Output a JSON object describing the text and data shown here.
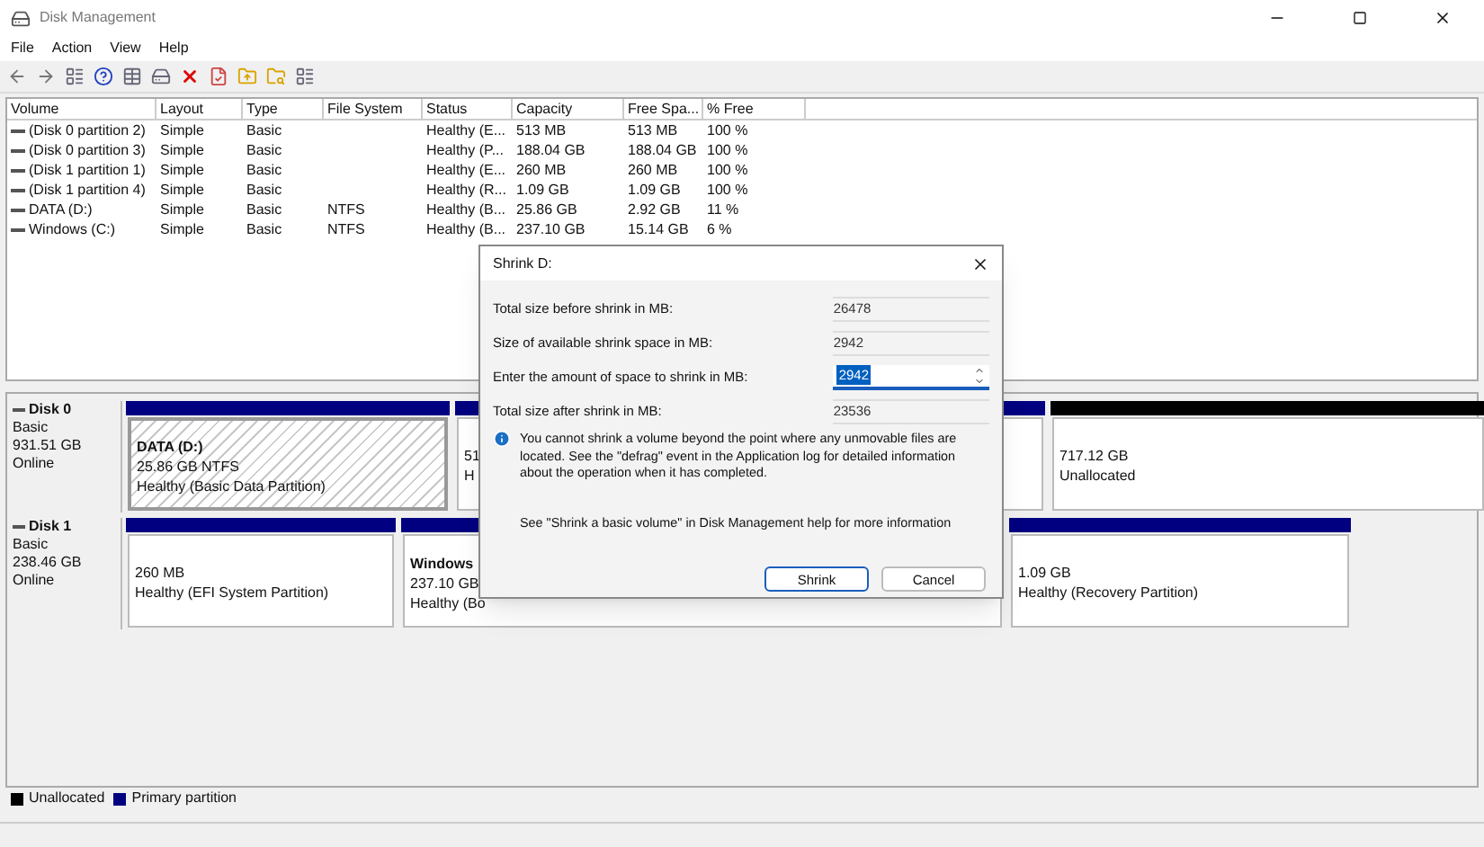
{
  "window": {
    "title": "Disk Management"
  },
  "menu": [
    "File",
    "Action",
    "View",
    "Help"
  ],
  "table": {
    "columns": [
      "Volume",
      "Layout",
      "Type",
      "File System",
      "Status",
      "Capacity",
      "Free Spa...",
      "% Free"
    ],
    "rows": [
      [
        "(Disk 0 partition 2)",
        "Simple",
        "Basic",
        "",
        "Healthy (E...",
        "513 MB",
        "513 MB",
        "100 %"
      ],
      [
        "(Disk 0 partition 3)",
        "Simple",
        "Basic",
        "",
        "Healthy (P...",
        "188.04 GB",
        "188.04 GB",
        "100 %"
      ],
      [
        "(Disk 1 partition 1)",
        "Simple",
        "Basic",
        "",
        "Healthy (E...",
        "260 MB",
        "260 MB",
        "100 %"
      ],
      [
        "(Disk 1 partition 4)",
        "Simple",
        "Basic",
        "",
        "Healthy (R...",
        "1.09 GB",
        "1.09 GB",
        "100 %"
      ],
      [
        "DATA (D:)",
        "Simple",
        "Basic",
        "NTFS",
        "Healthy (B...",
        "25.86 GB",
        "2.92 GB",
        "11 %"
      ],
      [
        "Windows (C:)",
        "Simple",
        "Basic",
        "NTFS",
        "Healthy (B...",
        "237.10 GB",
        "15.14 GB",
        "6 %"
      ]
    ]
  },
  "disks": [
    {
      "name": "Disk 0",
      "type": "Basic",
      "size": "931.51 GB",
      "status": "Online",
      "partitions": [
        {
          "kind": "primary",
          "selected": true,
          "name": "DATA  (D:)",
          "size": "25.86 GB NTFS",
          "status": "Healthy (Basic Data Partition)"
        },
        {
          "kind": "primary",
          "selected": false,
          "size": "51",
          "status": "H"
        },
        {
          "kind": "primary",
          "selected": false
        },
        {
          "kind": "unallocated",
          "selected": false,
          "size": "717.12 GB",
          "status": "Unallocated"
        }
      ]
    },
    {
      "name": "Disk 1",
      "type": "Basic",
      "size": "238.46 GB",
      "status": "Online",
      "partitions": [
        {
          "kind": "primary",
          "selected": false,
          "size": "260 MB",
          "status": "Healthy (EFI System Partition)"
        },
        {
          "kind": "primary",
          "selected": false,
          "name": "Windows",
          "size": "237.10 GB",
          "status": "Healthy (Bo"
        },
        {
          "kind": "primary",
          "selected": false,
          "size": "1.09 GB",
          "status": "Healthy (Recovery Partition)"
        }
      ]
    }
  ],
  "legend": [
    {
      "label": "Unallocated",
      "color": "#000000"
    },
    {
      "label": "Primary partition",
      "color": "#000080"
    }
  ],
  "dialog": {
    "title": "Shrink D:",
    "fields": [
      {
        "kind": "readonly",
        "label": "Total size before shrink in MB:",
        "value": "26478"
      },
      {
        "kind": "readonly",
        "label": "Size of available shrink space in MB:",
        "value": "2942"
      },
      {
        "kind": "spin",
        "label": "Enter the amount of space to shrink in MB:",
        "value": "2942"
      },
      {
        "kind": "readonly",
        "label": "Total size after shrink in MB:",
        "value": "23536"
      }
    ],
    "info": "You cannot shrink a volume beyond the point where any unmovable files are located. See the \"defrag\" event in the Application log for detailed information about the operation when it has completed.",
    "help": "See \"Shrink a basic volume\" in Disk Management help for more information",
    "buttons": [
      "Shrink",
      "Cancel"
    ]
  }
}
